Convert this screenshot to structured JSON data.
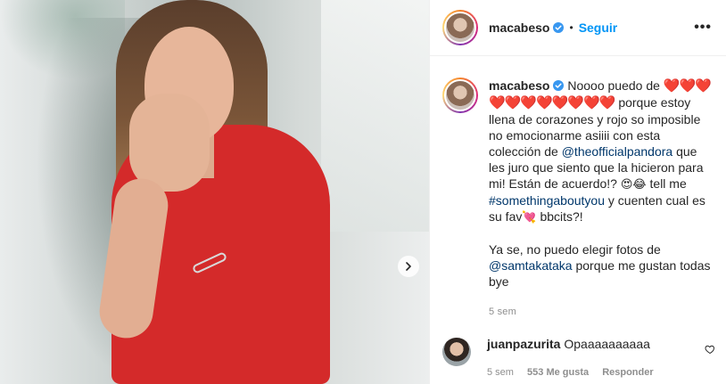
{
  "post": {
    "author": "macabeso",
    "follow_label": "Seguir",
    "dot": "•",
    "more_label": "•••"
  },
  "caption": {
    "username": "macabeso",
    "text_1": "Noooo puedo de",
    "hearts": "❤️❤️❤️❤️❤️❤️❤️❤️❤️❤️❤️",
    "text_2": "porque estoy llena de corazones y rojo so imposible no emocionarme asiiii con esta colección de",
    "mention_1": "@theofficialpandora",
    "text_3": "que les juro que siento que la hicieron para mi! Están de acuerdo!?",
    "emoji_1": "😍😂",
    "text_4": "tell me",
    "hashtag": "#somethingaboutyou",
    "text_5": "y cuenten cual es su fav",
    "emoji_2": "💘",
    "text_6": "bbcits?!",
    "para2_a": "Ya se, no puedo elegir fotos de",
    "mention_2": "@samtakataka",
    "para2_b": "porque me gustan todas bye",
    "time": "5 sem"
  },
  "comment": {
    "username": "juanpazurita",
    "text": "Opaaaaaaaaaa",
    "time": "5 sem",
    "likes": "553 Me gusta",
    "reply_label": "Responder"
  },
  "icons": {
    "verified": "verified-badge-icon",
    "next": "chevron-right-icon",
    "like": "heart-outline-icon"
  },
  "colors": {
    "link_blue": "#0095f6",
    "mention": "#00376b",
    "muted": "#8e8e8e",
    "dress_red": "#d42a2a"
  }
}
